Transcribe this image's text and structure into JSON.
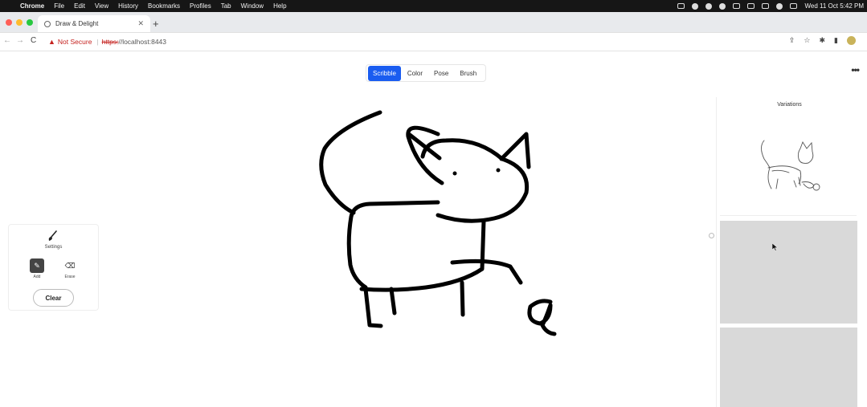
{
  "menubar": {
    "apple_icon": "apple-icon",
    "app_name": "Chrome",
    "items": [
      "File",
      "Edit",
      "View",
      "History",
      "Bookmarks",
      "Profiles",
      "Tab",
      "Window",
      "Help"
    ],
    "datetime": "Wed 11 Oct  5:42 PM"
  },
  "browser": {
    "tab_title": "Draw & Delight",
    "tab_close": "✕",
    "new_tab": "+",
    "back": "←",
    "forward": "→",
    "reload": "C",
    "warning_icon": "▲",
    "security_label": "Not Secure",
    "separator": "|",
    "url_scheme": "https:",
    "url_rest": "//localhost:8443"
  },
  "page": {
    "mode_tabs": [
      "Scribble",
      "Color",
      "Pose",
      "Brush"
    ],
    "active_mode": "Scribble",
    "more": "•••",
    "tools": {
      "settings_label": "Settings",
      "add_label": "Add",
      "erase_label": "Erase",
      "clear_label": "Clear"
    },
    "variations_title": "Variations"
  },
  "colors": {
    "accent": "#1a5cf0",
    "warning": "#c5221f",
    "stroke": "#000000",
    "placeholder": "#d9d9d9"
  }
}
